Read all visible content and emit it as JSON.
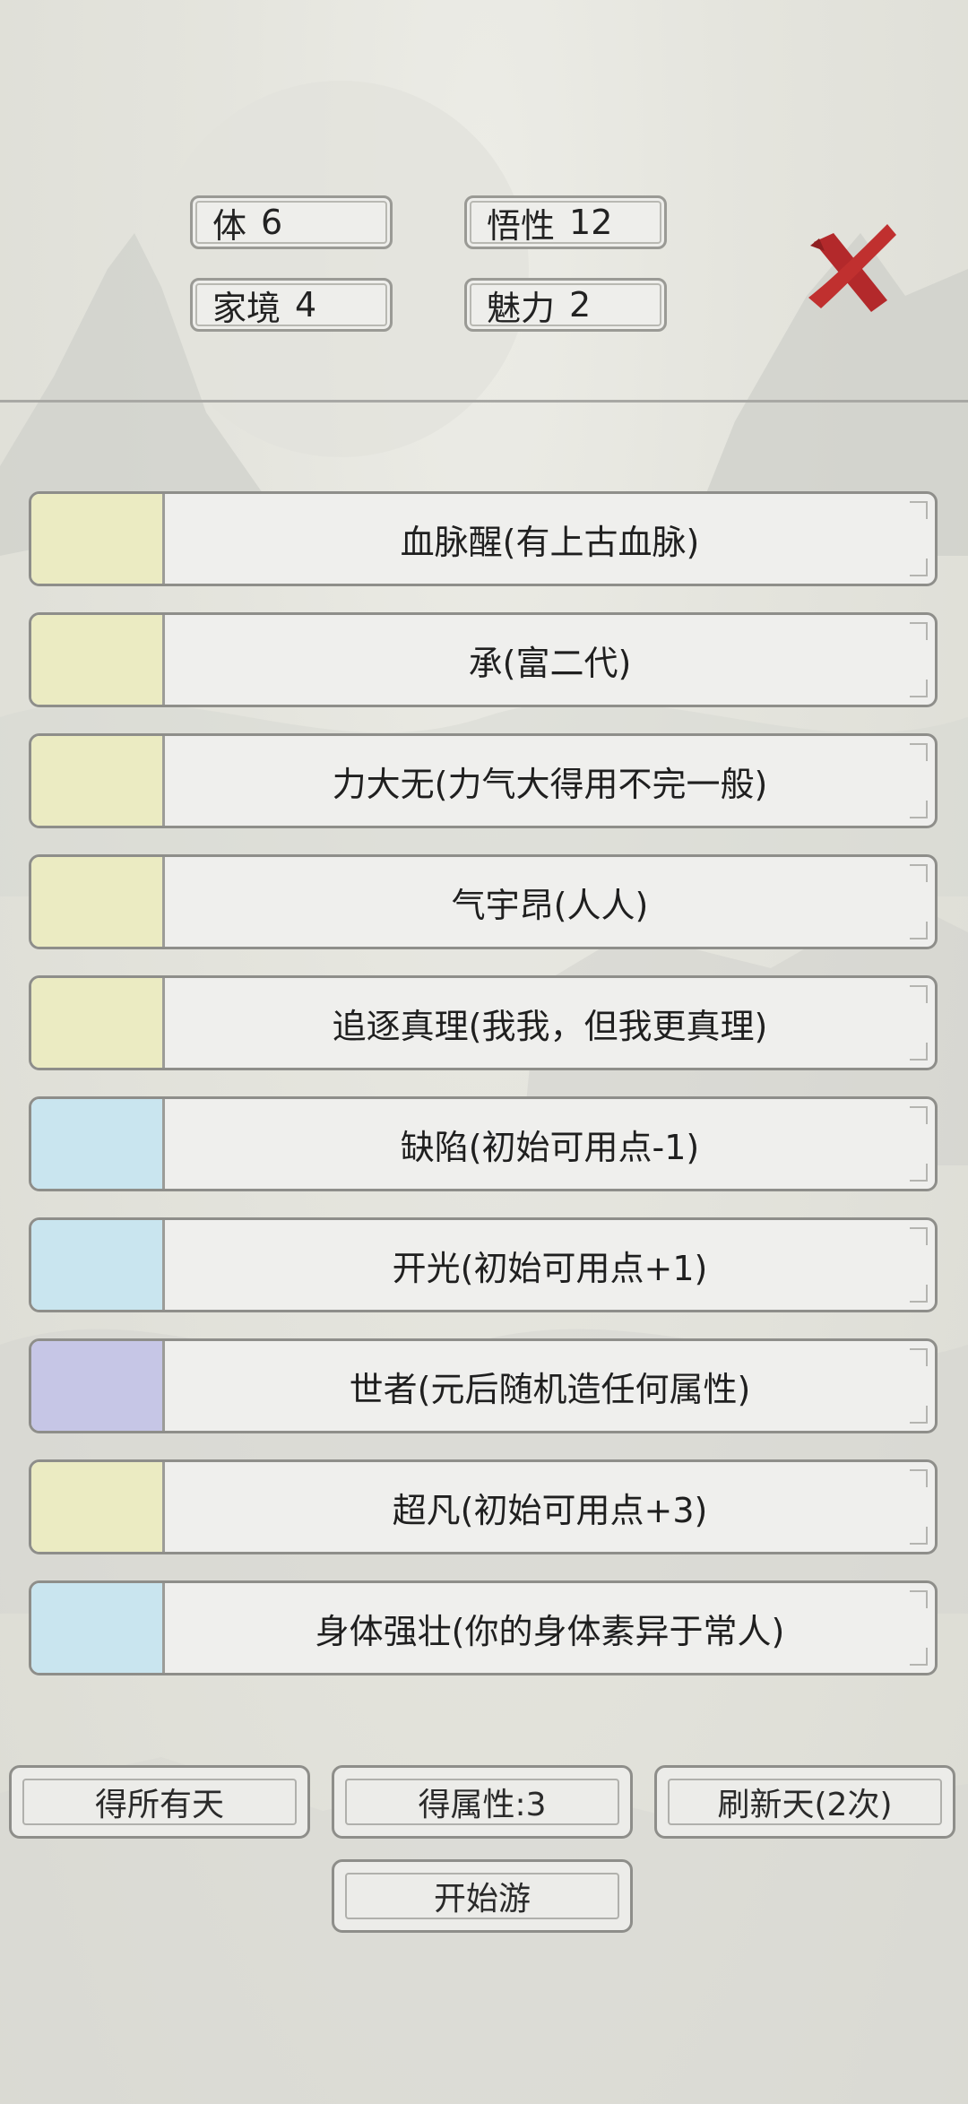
{
  "stats": [
    {
      "label": "体",
      "value": "6"
    },
    {
      "label": "悟性",
      "value": "12"
    },
    {
      "label": "家境",
      "value": "4"
    },
    {
      "label": "魅力",
      "value": "2"
    }
  ],
  "close_icon": "close-x-icon",
  "traits": [
    {
      "label": "血脉醒(有上古血脉)",
      "color": "#ebebc2"
    },
    {
      "label": "承(富二代)",
      "color": "#ebebc2"
    },
    {
      "label": "力大无(力气大得用不完一般)",
      "color": "#ebebc2"
    },
    {
      "label": "气宇昂(人人)",
      "color": "#ebebc2"
    },
    {
      "label": "追逐真理(我我，但我更真理)",
      "color": "#ebebc2"
    },
    {
      "label": "缺陷(初始可用点-1)",
      "color": "#c9e5ef"
    },
    {
      "label": "开光(初始可用点+1)",
      "color": "#c9e5ef"
    },
    {
      "label": "世者(元后随机造任何属性)",
      "color": "#c6c6e6"
    },
    {
      "label": "超凡(初始可用点+3)",
      "color": "#ebebc2"
    },
    {
      "label": "身体强壮(你的身体素异于常人)",
      "color": "#c9e5ef"
    }
  ],
  "buttons": {
    "get_all": "得所有天",
    "get_attr": "得属性:3",
    "refresh": "刷新天(2次)",
    "start": "开始游"
  }
}
